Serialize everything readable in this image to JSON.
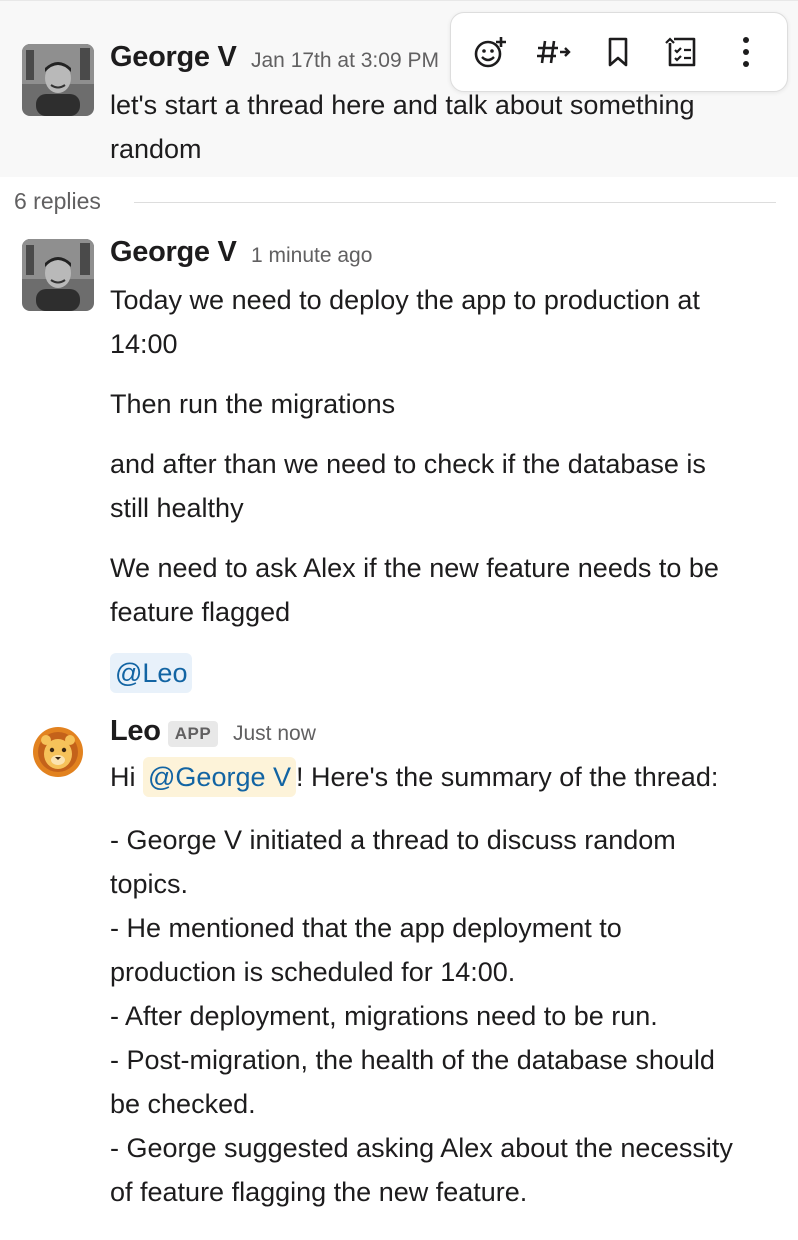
{
  "parent_message": {
    "author": "George V",
    "timestamp": "Jan 17th at 3:09 PM",
    "text": "let's start a thread here and talk about something random"
  },
  "toolbar": {
    "icons": [
      "add-reaction-icon",
      "forward-to-channel-icon",
      "bookmark-icon",
      "add-task-icon",
      "more-actions-icon"
    ]
  },
  "thread": {
    "replies_label": "6 replies"
  },
  "reply1": {
    "author": "George V",
    "timestamp": "1 minute ago",
    "line1": "Today we need to deploy the app to production at",
    "line2": "14:00",
    "para2": "Then run the migrations",
    "para3_line1": "and after than we need to check if the database is",
    "para3_line2": "still healthy",
    "para4_line1": "We need to ask Alex if the new feature needs to be",
    "para4_line2": "feature flagged",
    "mention": "@Leo"
  },
  "reply2": {
    "author": "Leo",
    "badge": "APP",
    "timestamp": "Just now",
    "greeting_prefix": "Hi",
    "greeting_mention": "@George V",
    "greeting_suffix": "! Here's the summary of the thread:",
    "summary_lines": [
      "- George V initiated a thread to discuss random",
      "topics.",
      "- He mentioned that the app deployment to",
      "production is scheduled for 14:00.",
      "- After deployment, migrations need to be run.",
      "- Post-migration, the health of the database should",
      "be checked.",
      "- George suggested asking Alex about the necessity",
      "of feature flagging the new feature."
    ]
  }
}
